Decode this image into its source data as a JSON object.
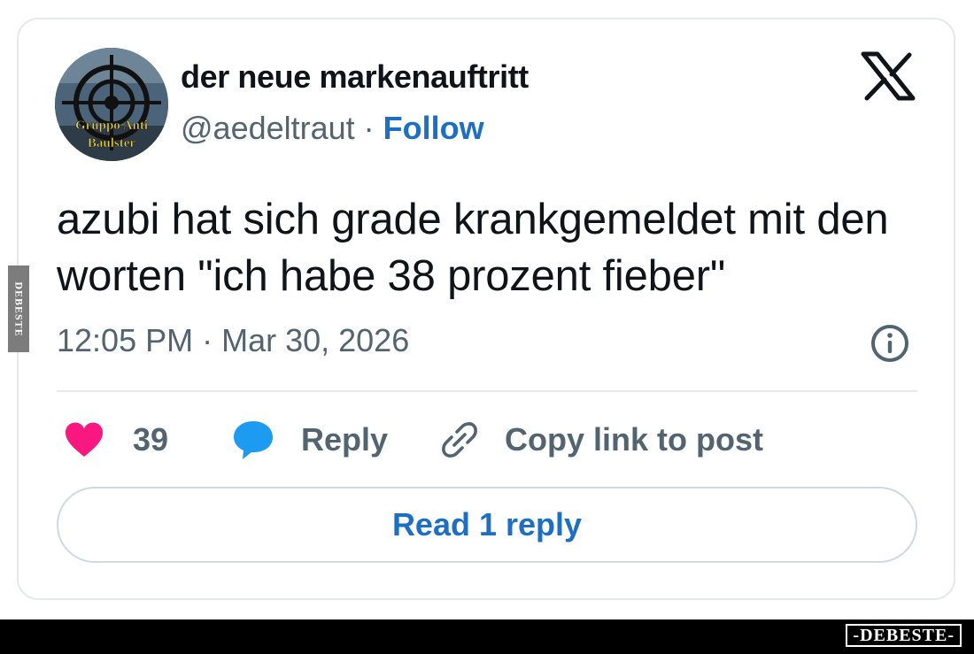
{
  "tweet": {
    "display_name": "der neue markenauftritt",
    "handle": "@aedeltraut",
    "separator": " · ",
    "follow_label": "Follow",
    "text": "azubi hat sich grade krankgemeldet mit den worten \"ich habe 38 prozent fieber\"",
    "timestamp": "12:05 PM · Mar 30, 2026",
    "avatar_text": "Gruppo Anti Baulster"
  },
  "actions": {
    "like_count": "39",
    "reply_label": "Reply",
    "copy_label": "Copy link to post"
  },
  "read_replies_label": "Read 1 reply",
  "icons": {
    "platform": "x-logo-icon",
    "info": "info-icon",
    "like": "heart-icon",
    "reply": "speech-bubble-icon",
    "copy": "link-icon"
  },
  "colors": {
    "link_blue": "#1d6fc4",
    "heart": "#f91880",
    "reply_bubble": "#1d9bf0",
    "muted_text": "#536471"
  },
  "watermark": {
    "side": "DEBESTE",
    "bottom": "-DEBESTE-"
  }
}
